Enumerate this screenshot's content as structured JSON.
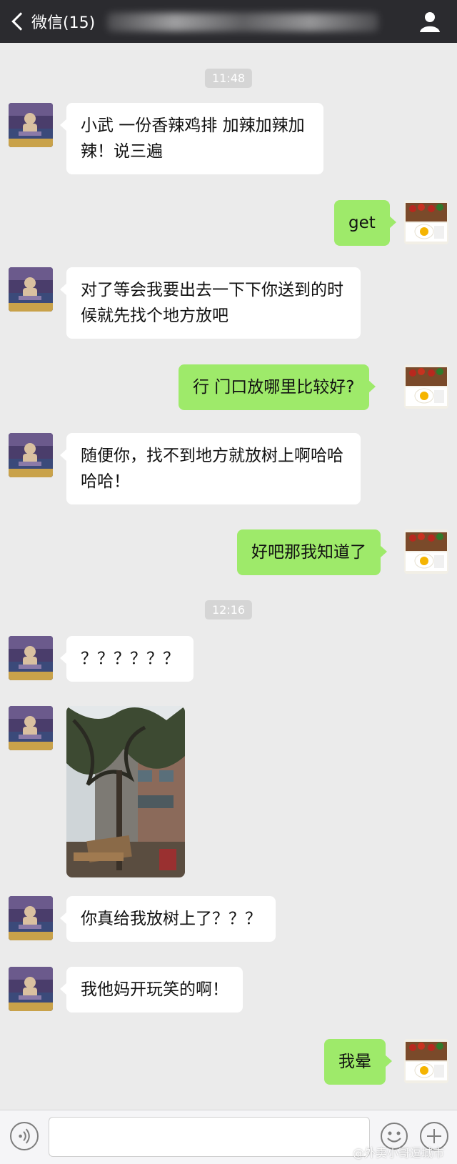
{
  "header": {
    "back_label": "微信(15)",
    "back_icon": "chevron-left-icon",
    "contact_icon": "person-icon"
  },
  "timestamps": [
    "11:48",
    "12:16"
  ],
  "messages": [
    {
      "side": "left",
      "text": "小武 一份香辣鸡排 加辣加辣加辣！说三遍"
    },
    {
      "side": "right",
      "text": "get"
    },
    {
      "side": "left",
      "text": "对了等会我要出去一下下你送到的时候就先找个地方放吧"
    },
    {
      "side": "right",
      "text": "行 门口放哪里比较好?"
    },
    {
      "side": "left",
      "text": "随便你，找不到地方就放树上啊哈哈哈哈！"
    },
    {
      "side": "right",
      "text": "好吧那我知道了"
    },
    {
      "side": "left",
      "text": "？？？？？？"
    },
    {
      "side": "left",
      "type": "image",
      "content": "street-tree-photo"
    },
    {
      "side": "left",
      "text": "你真给我放树上了？？？"
    },
    {
      "side": "left",
      "text": "我他妈开玩笑的啊！"
    },
    {
      "side": "right",
      "text": "我晕"
    }
  ],
  "input_bar": {
    "voice_icon": "voice-icon",
    "input_value": "",
    "emoji_icon": "emoji-icon",
    "more_icon": "plus-icon"
  },
  "watermark": "@外卖小哥逗城市",
  "colors": {
    "header_bg": "#2b2b2f",
    "chat_bg": "#ebebeb",
    "bubble_self": "#9eea6a",
    "bubble_other": "#ffffff",
    "timestamp_bg": "#d5d5d5"
  }
}
